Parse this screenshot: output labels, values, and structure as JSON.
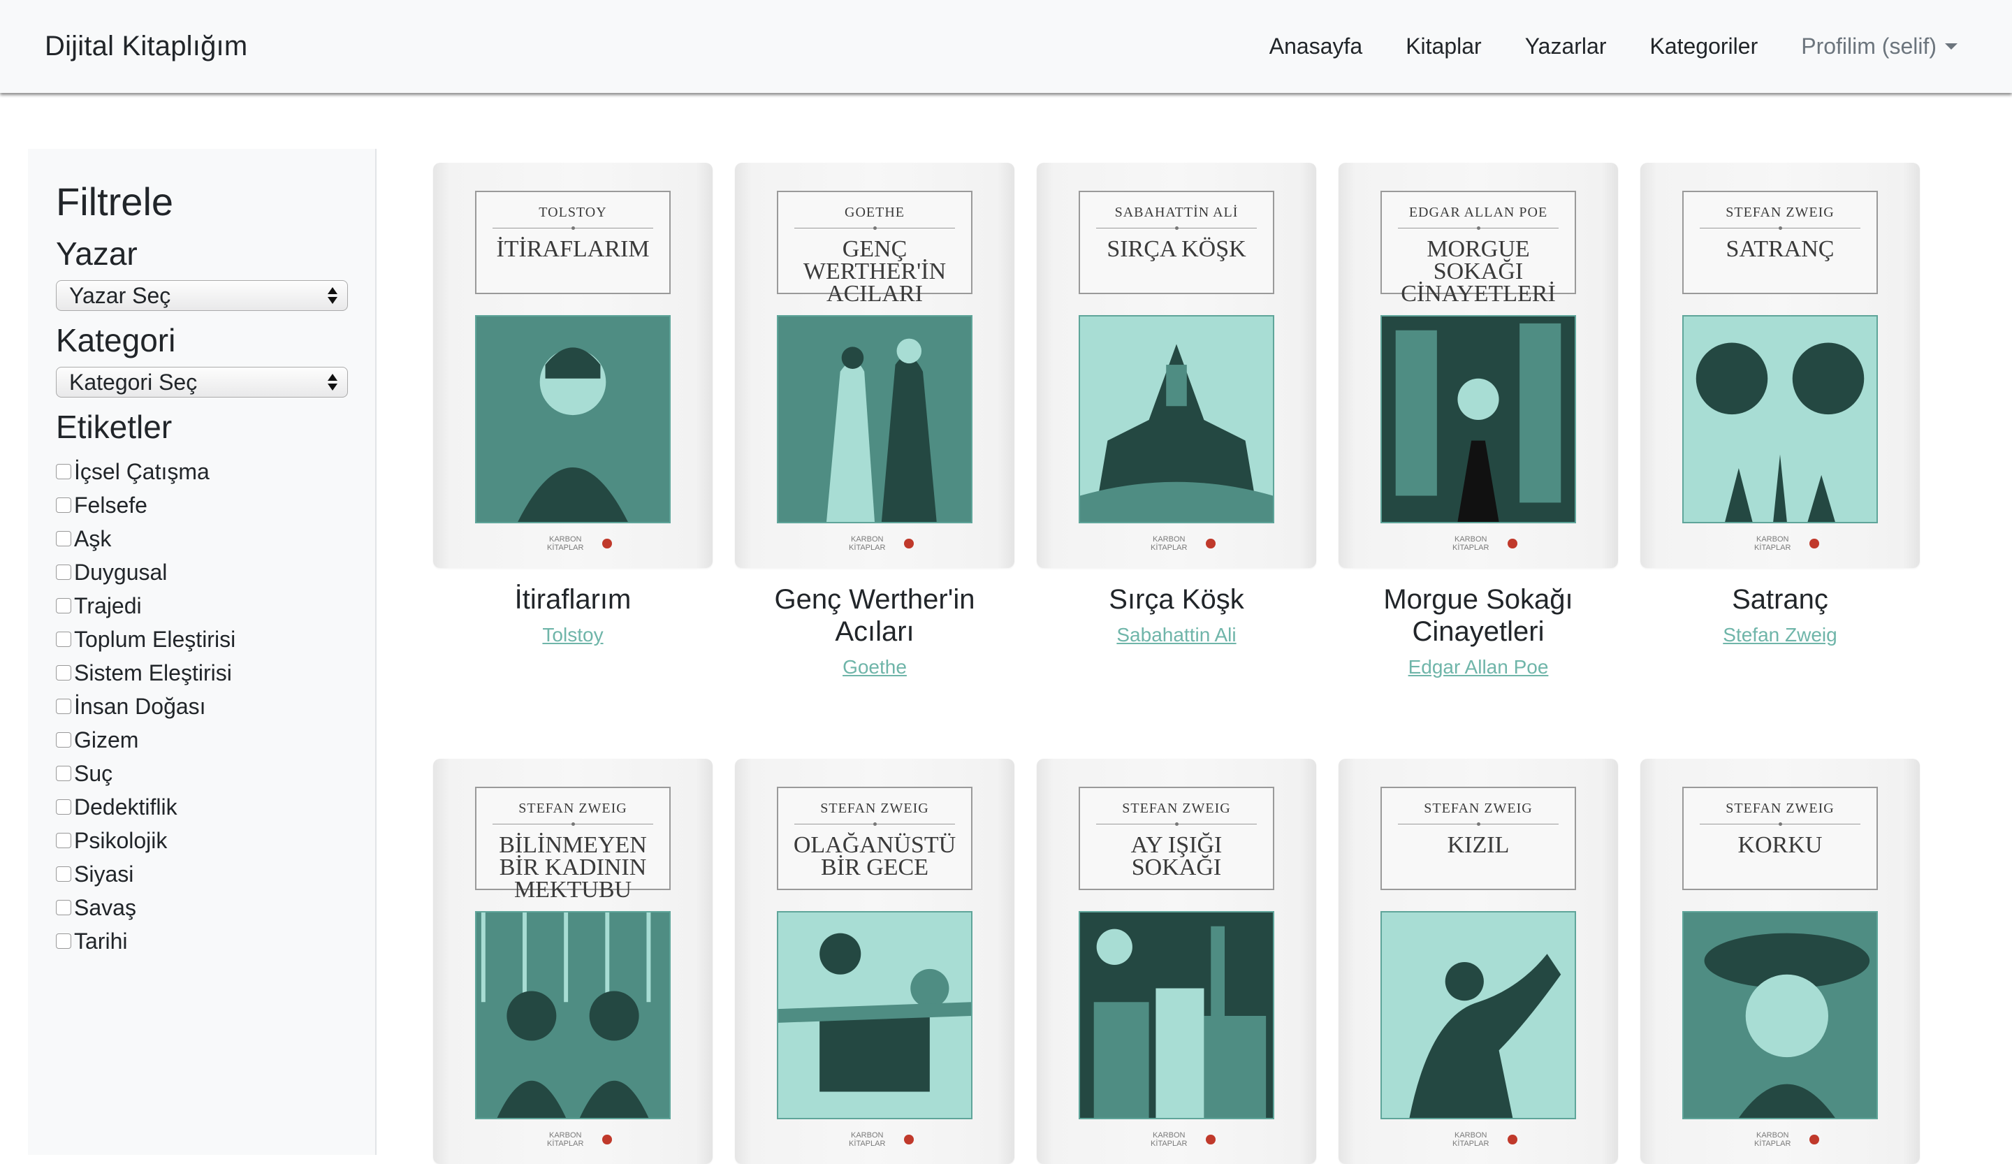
{
  "navbar": {
    "brand": "Dijital Kitaplığım",
    "links": [
      "Anasayfa",
      "Kitaplar",
      "Yazarlar",
      "Kategoriler"
    ],
    "profile": "Profilim (selif)"
  },
  "sidebar": {
    "title": "Filtrele",
    "author_heading": "Yazar",
    "author_select": "Yazar Seç",
    "category_heading": "Kategori",
    "category_select": "Kategori Seç",
    "tags_heading": "Etiketler",
    "tags": [
      "İçsel Çatışma",
      "Felsefe",
      "Aşk",
      "Duygusal",
      "Trajedi",
      "Toplum Eleştirisi",
      "Sistem Eleştirisi",
      "İnsan Doğası",
      "Gizem",
      "Suç",
      "Dedektiflik",
      "Psikolojik",
      "Siyasi",
      "Savaş",
      "Tarihi"
    ]
  },
  "books": [
    {
      "title": "İtiraflarım",
      "author": "Tolstoy",
      "cover_author": "TOLSTOY",
      "cover_title": "İTİRAFLARIM"
    },
    {
      "title": "Genç Werther'in Acıları",
      "author": "Goethe",
      "cover_author": "GOETHE",
      "cover_title": "GENÇ WERTHER'İN ACILARI"
    },
    {
      "title": "Sırça Köşk",
      "author": "Sabahattin Ali",
      "cover_author": "SABAHATTİN ALİ",
      "cover_title": "SIRÇA KÖŞK"
    },
    {
      "title": "Morgue Sokağı Cinayetleri",
      "author": "Edgar Allan Poe",
      "cover_author": "EDGAR ALLAN POE",
      "cover_title": "MORGUE SOKAĞI CİNAYETLERİ"
    },
    {
      "title": "Satranç",
      "author": "Stefan Zweig",
      "cover_author": "STEFAN ZWEIG",
      "cover_title": "SATRANÇ"
    },
    {
      "title": "",
      "author": "",
      "cover_author": "STEFAN ZWEIG",
      "cover_title": "BİLİNMEYEN BİR KADININ MEKTUBU"
    },
    {
      "title": "",
      "author": "",
      "cover_author": "STEFAN ZWEIG",
      "cover_title": "OLAĞANÜSTÜ BİR GECE"
    },
    {
      "title": "",
      "author": "",
      "cover_author": "STEFAN ZWEIG",
      "cover_title": "AY IŞIĞI SOKAĞI"
    },
    {
      "title": "",
      "author": "",
      "cover_author": "STEFAN ZWEIG",
      "cover_title": "KIZIL"
    },
    {
      "title": "",
      "author": "",
      "cover_author": "STEFAN ZWEIG",
      "cover_title": "KORKU"
    }
  ],
  "publisher_text": "KARBON KİTAPLAR",
  "colors": {
    "accent": "#6fb5a9",
    "art": "#7cc4b8",
    "navbar": "#f8f9fa"
  }
}
